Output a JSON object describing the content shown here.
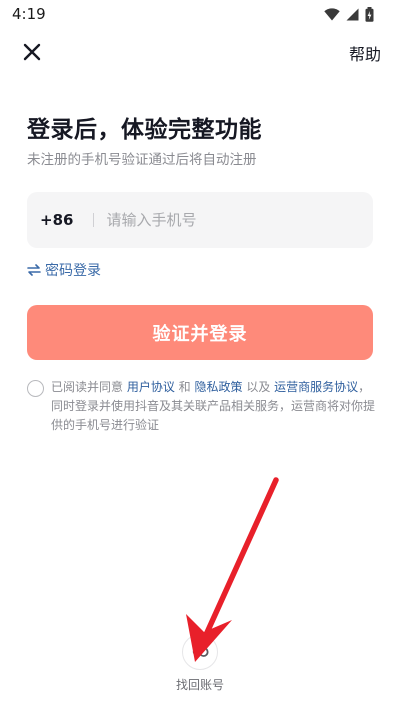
{
  "status_bar": {
    "time": "4:19"
  },
  "header": {
    "help_label": "帮助"
  },
  "main": {
    "title": "登录后，体验完整功能",
    "subtitle": "未注册的手机号验证通过后将自动注册",
    "phone": {
      "country_code": "+86",
      "placeholder": "请输入手机号",
      "value": ""
    },
    "password_login_label": "密码登录",
    "login_button_label": "验证并登录"
  },
  "agreement": {
    "prefix": "已阅读并同意 ",
    "user_agreement": "用户协议",
    "and": " 和 ",
    "privacy_policy": "隐私政策",
    "also": " 以及 ",
    "operator_agreement": "运营商服务协议",
    "suffix": "，同时登录并使用抖音及其关联产品相关服务，运营商将对你提供的手机号进行验证"
  },
  "footer": {
    "recover_label": "找回账号"
  },
  "colors": {
    "accent": "#fe8a7a",
    "link": "#2f5f9e",
    "arrow": "#e8202a"
  }
}
